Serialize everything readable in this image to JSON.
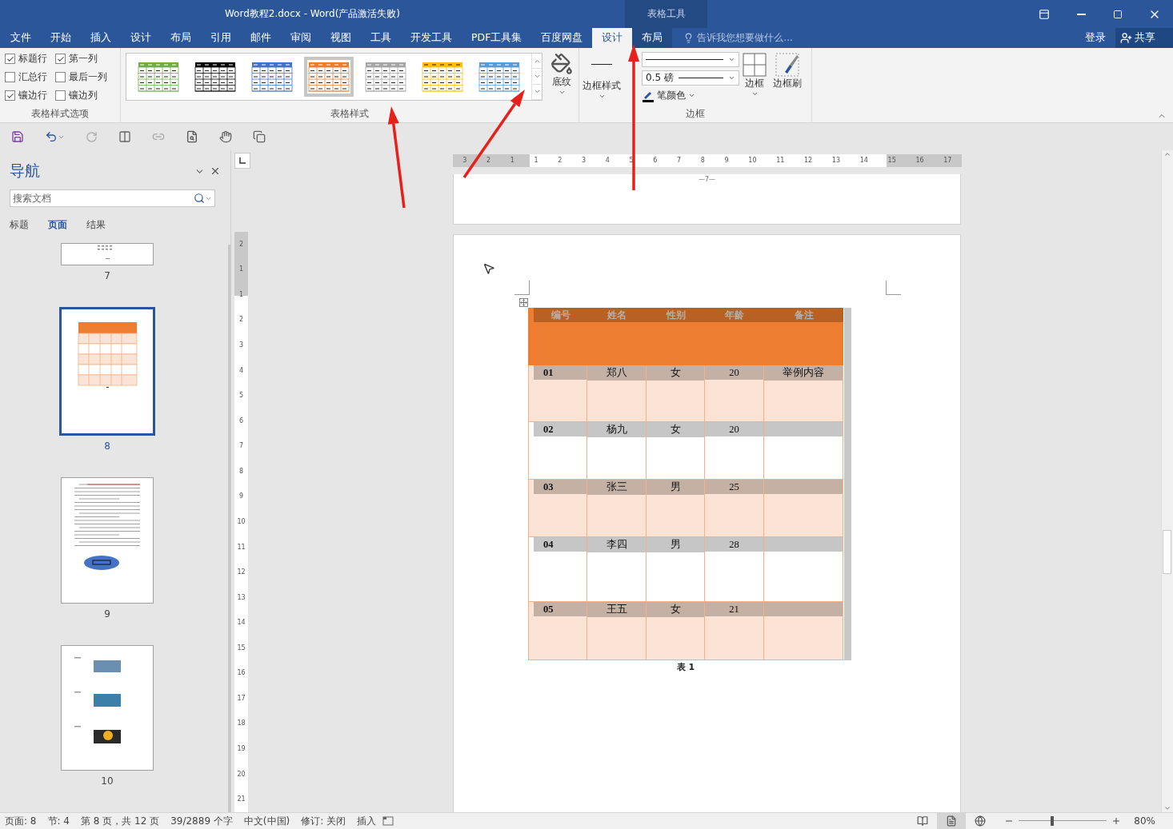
{
  "window": {
    "title": "Word教程2.docx - Word(产品激活失败)",
    "context_group": "表格工具"
  },
  "menu_tabs": [
    {
      "label": "文件",
      "selected": false,
      "kind": "normal"
    },
    {
      "label": "开始",
      "selected": false,
      "kind": "normal"
    },
    {
      "label": "插入",
      "selected": false,
      "kind": "normal"
    },
    {
      "label": "设计",
      "selected": false,
      "kind": "normal"
    },
    {
      "label": "布局",
      "selected": false,
      "kind": "normal"
    },
    {
      "label": "引用",
      "selected": false,
      "kind": "normal"
    },
    {
      "label": "邮件",
      "selected": false,
      "kind": "normal"
    },
    {
      "label": "审阅",
      "selected": false,
      "kind": "normal"
    },
    {
      "label": "视图",
      "selected": false,
      "kind": "normal"
    },
    {
      "label": "工具",
      "selected": false,
      "kind": "normal"
    },
    {
      "label": "开发工具",
      "selected": false,
      "kind": "normal"
    },
    {
      "label": "PDF工具集",
      "selected": false,
      "kind": "normal"
    },
    {
      "label": "百度网盘",
      "selected": false,
      "kind": "normal"
    },
    {
      "label": "设计",
      "selected": true,
      "kind": "context"
    },
    {
      "label": "布局",
      "selected": false,
      "kind": "context"
    }
  ],
  "tell_me": {
    "placeholder": "告诉我您想要做什么..."
  },
  "account": {
    "sign_in": "登录",
    "share": "共享"
  },
  "ribbon": {
    "style_options": {
      "group_label": "表格样式选项",
      "items": [
        {
          "label": "标题行",
          "checked": true
        },
        {
          "label": "第一列",
          "checked": true
        },
        {
          "label": "汇总行",
          "checked": false
        },
        {
          "label": "最后一列",
          "checked": false
        },
        {
          "label": "镶边行",
          "checked": true
        },
        {
          "label": "镶边列",
          "checked": false
        }
      ]
    },
    "table_styles": {
      "group_label": "表格样式",
      "shading_label": "底纹",
      "styles": [
        {
          "color": "#70ad47",
          "selected": false
        },
        {
          "color": "#000000",
          "selected": false
        },
        {
          "color": "#4472c4",
          "selected": false
        },
        {
          "color": "#ed7d31",
          "selected": true
        },
        {
          "color": "#a5a5a5",
          "selected": false
        },
        {
          "color": "#ffc000",
          "selected": false
        },
        {
          "color": "#5b9bd5",
          "selected": false
        }
      ]
    },
    "borders": {
      "group_label": "边框",
      "border_styles_label": "边框样式",
      "pen_weight": "0.5 磅",
      "pen_color_label": "笔颜色",
      "borders_label": "边框",
      "painter_label": "边框刷"
    }
  },
  "navigation": {
    "title": "导航",
    "search": {
      "placeholder": "搜索文档"
    },
    "tabs": [
      {
        "label": "标题",
        "selected": false
      },
      {
        "label": "页面",
        "selected": true
      },
      {
        "label": "结果",
        "selected": false
      }
    ],
    "pages": [
      {
        "number": "7",
        "selected": false,
        "kind": "partial"
      },
      {
        "number": "8",
        "selected": true,
        "kind": "table"
      },
      {
        "number": "9",
        "selected": false,
        "kind": "text"
      },
      {
        "number": "10",
        "selected": false,
        "kind": "images"
      }
    ]
  },
  "rulers": {
    "horizontal": [
      "3",
      "2",
      "1",
      "1",
      "2",
      "3",
      "4",
      "5",
      "6",
      "7",
      "8",
      "9",
      "10",
      "11",
      "12",
      "13",
      "14",
      "15",
      "16",
      "17"
    ],
    "vertical": [
      "2",
      "1",
      "1",
      "2",
      "3",
      "4",
      "5",
      "6",
      "7",
      "8",
      "9",
      "10",
      "11",
      "12",
      "13",
      "14",
      "15",
      "16",
      "17",
      "18",
      "19",
      "20",
      "21"
    ]
  },
  "document": {
    "previous_page_number": "—7—",
    "table": {
      "columns": [
        "编号",
        "姓名",
        "性别",
        "年龄",
        "备注"
      ],
      "rows": [
        {
          "cells": [
            "01",
            "郑八",
            "女",
            "20",
            "举例内容"
          ]
        },
        {
          "cells": [
            "02",
            "杨九",
            "女",
            "20"
          ]
        },
        {
          "cells": [
            "03",
            "张三",
            "男",
            "25"
          ]
        },
        {
          "cells": [
            "04",
            "李四",
            "男",
            "28"
          ]
        },
        {
          "cells": [
            "05",
            "王五",
            "女",
            "21"
          ]
        }
      ],
      "caption": "表 1"
    }
  },
  "status_bar": {
    "items": [
      "页面: 8",
      "节: 4",
      "第 8 页，共 12 页",
      "39/2889 个字",
      "中文(中国)",
      "修订: 关闭",
      "插入"
    ],
    "views": [
      {
        "kind": "read",
        "selected": false
      },
      {
        "kind": "print",
        "selected": true
      },
      {
        "kind": "web",
        "selected": false
      }
    ],
    "zoom": {
      "level": 0.38,
      "reading": "80%"
    }
  }
}
